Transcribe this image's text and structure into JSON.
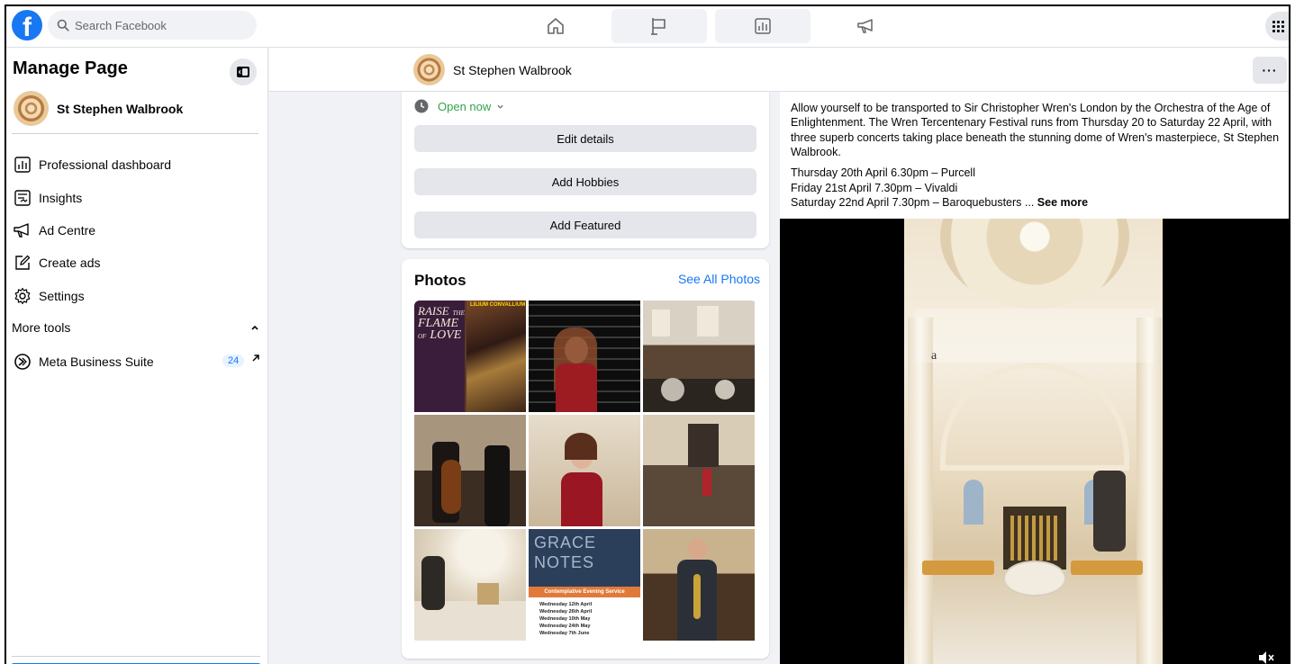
{
  "topbar": {
    "logo": "f",
    "search_placeholder": "Search Facebook",
    "nav": [
      "home-icon",
      "flag-icon",
      "dashboard-icon",
      "megaphone-icon"
    ]
  },
  "sidebar": {
    "title": "Manage Page",
    "page_name": "St Stephen Walbrook",
    "items": [
      {
        "label": "Professional dashboard",
        "icon": "dashboard-icon"
      },
      {
        "label": "Insights",
        "icon": "insights-icon"
      },
      {
        "label": "Ad Centre",
        "icon": "megaphone-icon"
      },
      {
        "label": "Create ads",
        "icon": "pencil-icon"
      },
      {
        "label": "Settings",
        "icon": "gear-icon"
      }
    ],
    "more_tools": "More tools",
    "meta": {
      "label": "Meta Business Suite",
      "badge": "24"
    }
  },
  "header": {
    "page_name": "St Stephen Walbrook",
    "more": "···"
  },
  "intro": {
    "open_status": "Open now",
    "buttons": [
      "Edit details",
      "Add Hobbies",
      "Add Featured"
    ]
  },
  "photos": {
    "title": "Photos",
    "see_all": "See All Photos",
    "tile1": {
      "line1": "RAISE",
      "line1b": "THE",
      "line2": "FLAME",
      "line3b": "OF",
      "line3": "LOVE",
      "banner": "LILIUM CONVALLIUM"
    },
    "tile8": {
      "line1": "GRACE",
      "line2": "NOTES",
      "band": "Contemplative Evening Service",
      "dates": [
        "Wednesday 12th April",
        "Wednesday 26th April",
        "Wednesday 10th May",
        "Wednesday 24th May",
        "Wednesday 7th June"
      ]
    }
  },
  "post": {
    "text": "Allow yourself to be transported to Sir Christopher Wren's London by the Orchestra of the Age of Enlightenment. The Wren Tercentenary Festival runs from Thursday 20 to Saturday 22 April, with three superb concerts taking place beneath the stunning dome of Wren's masterpiece, St Stephen Walbrook.",
    "line1": "Thursday 20th April 6.30pm – Purcell",
    "line2": "Friday 21st April 7.30pm – Vivaldi",
    "line3": "Saturday 22nd April 7.30pm – Baroquebusters ...",
    "see_more": "See more",
    "video_caption": "a"
  },
  "colors": {
    "accent": "#1877f2",
    "open_green": "#31a24c",
    "button_gray": "#e4e6eb",
    "background": "#f0f2f5"
  }
}
